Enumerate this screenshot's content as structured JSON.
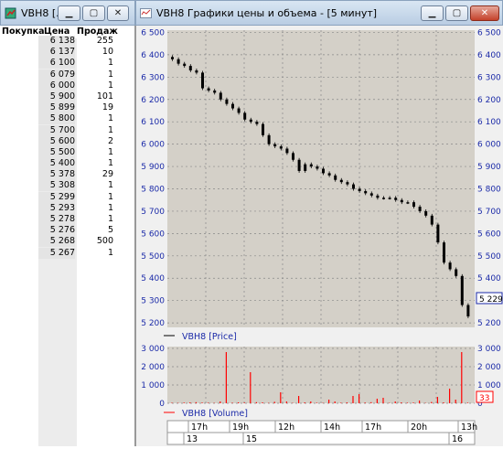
{
  "order_book": {
    "title": "VBH8 [...",
    "headers": {
      "buy": "Покупка",
      "price": "Цена",
      "sell": "Продаж"
    },
    "rows": [
      {
        "price": "6 138",
        "sell": "255"
      },
      {
        "price": "6 137",
        "sell": "10"
      },
      {
        "price": "6 100",
        "sell": "1"
      },
      {
        "price": "6 079",
        "sell": "1"
      },
      {
        "price": "6 000",
        "sell": "1"
      },
      {
        "price": "5 900",
        "sell": "101"
      },
      {
        "price": "5 899",
        "sell": "19"
      },
      {
        "price": "5 800",
        "sell": "1"
      },
      {
        "price": "5 700",
        "sell": "1"
      },
      {
        "price": "5 600",
        "sell": "2"
      },
      {
        "price": "5 500",
        "sell": "1"
      },
      {
        "price": "5 400",
        "sell": "1"
      },
      {
        "price": "5 378",
        "sell": "29"
      },
      {
        "price": "5 308",
        "sell": "1"
      },
      {
        "price": "5 299",
        "sell": "1"
      },
      {
        "price": "5 293",
        "sell": "1"
      },
      {
        "price": "5 278",
        "sell": "1"
      },
      {
        "price": "5 276",
        "sell": "5"
      },
      {
        "price": "5 268",
        "sell": "500"
      },
      {
        "price": "5 267",
        "sell": "1"
      }
    ]
  },
  "chart_window": {
    "title": "VBH8 Графики цены и объема - [5 минут]",
    "price_legend": "VBH8 [Price]",
    "volume_legend": "VBH8 [Volume]",
    "last_price_label": "5 229",
    "last_volume_label": "33",
    "time_labels": [
      "17h",
      "19h",
      "12h",
      "14h",
      "17h",
      "20h",
      "13h"
    ],
    "date_labels": [
      "13",
      "15",
      "16"
    ]
  },
  "colors": {
    "axis_text": "#1b2aa8",
    "grid": "#888888",
    "candle": "#000000",
    "volume": "#ff0000",
    "plot_bg": "#d4d0c8"
  },
  "chart_data": [
    {
      "type": "candlestick",
      "series_name": "VBH8 [Price]",
      "y_ticks": [
        5200,
        5300,
        5400,
        5500,
        5600,
        5700,
        5800,
        5900,
        6000,
        6100,
        6200,
        6300,
        6400,
        6500
      ],
      "ylim": [
        5180,
        6510
      ],
      "grid": true,
      "close_approx": [
        6380,
        6360,
        6350,
        6330,
        6320,
        6250,
        6240,
        6230,
        6200,
        6180,
        6160,
        6140,
        6110,
        6100,
        6090,
        6040,
        6000,
        5990,
        5980,
        5960,
        5930,
        5880,
        5910,
        5900,
        5890,
        5870,
        5860,
        5840,
        5830,
        5820,
        5800,
        5790,
        5780,
        5770,
        5760,
        5760,
        5760,
        5750,
        5740,
        5740,
        5720,
        5700,
        5680,
        5640,
        5560,
        5470,
        5440,
        5410,
        5280,
        5229
      ],
      "last_value": 5229
    },
    {
      "type": "bar",
      "series_name": "VBH8 [Volume]",
      "y_ticks": [
        0,
        1000,
        2000,
        3000
      ],
      "ylim": [
        0,
        3100
      ],
      "grid": true,
      "values_approx": [
        30,
        20,
        40,
        50,
        60,
        40,
        30,
        20,
        100,
        2800,
        30,
        50,
        40,
        1700,
        60,
        50,
        20,
        80,
        600,
        100,
        20,
        400,
        50,
        100,
        30,
        20,
        200,
        100,
        30,
        50,
        400,
        500,
        40,
        60,
        250,
        300,
        20,
        100,
        50,
        30,
        40,
        150,
        20,
        70,
        350,
        50,
        800,
        200,
        2800,
        33
      ],
      "last_value": 33
    }
  ]
}
